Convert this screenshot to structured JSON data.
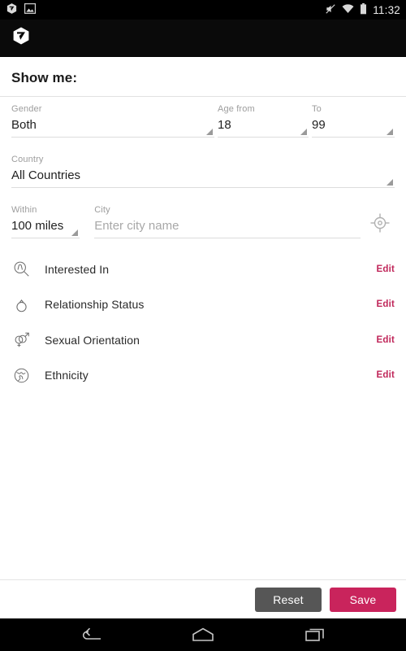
{
  "statusbar": {
    "time": "11:32",
    "left_icons": [
      "app-logo-icon",
      "screenshot-image-icon"
    ],
    "right_icons": [
      "mute-icon",
      "wifi-icon",
      "battery-icon"
    ]
  },
  "actionbar": {
    "logo": "app-logo-icon"
  },
  "main": {
    "title": "Show me:",
    "fields": {
      "gender": {
        "label": "Gender",
        "value": "Both"
      },
      "age_from": {
        "label": "Age from",
        "value": "18"
      },
      "age_to": {
        "label": "To",
        "value": "99"
      },
      "country": {
        "label": "Country",
        "value": "All Countries"
      },
      "within": {
        "label": "Within",
        "value": "100 miles"
      },
      "city": {
        "label": "City",
        "value": "",
        "placeholder": "Enter city name"
      }
    },
    "location_button": "locate-me",
    "list": [
      {
        "icon": "interested-in-icon",
        "label": "Interested In",
        "action": "Edit"
      },
      {
        "icon": "relationship-ring-icon",
        "label": "Relationship Status",
        "action": "Edit"
      },
      {
        "icon": "sexual-orientation-icon",
        "label": "Sexual Orientation",
        "action": "Edit"
      },
      {
        "icon": "globe-icon",
        "label": "Ethnicity",
        "action": "Edit"
      }
    ]
  },
  "footer": {
    "reset_label": "Reset",
    "save_label": "Save"
  },
  "navbar": {
    "back": "back-icon",
    "home": "home-icon",
    "recents": "recents-icon"
  },
  "colors": {
    "accent": "#c9245c",
    "edit_link": "#c0275a",
    "reset_button": "#565656",
    "label_gray": "#9d9d9d"
  }
}
